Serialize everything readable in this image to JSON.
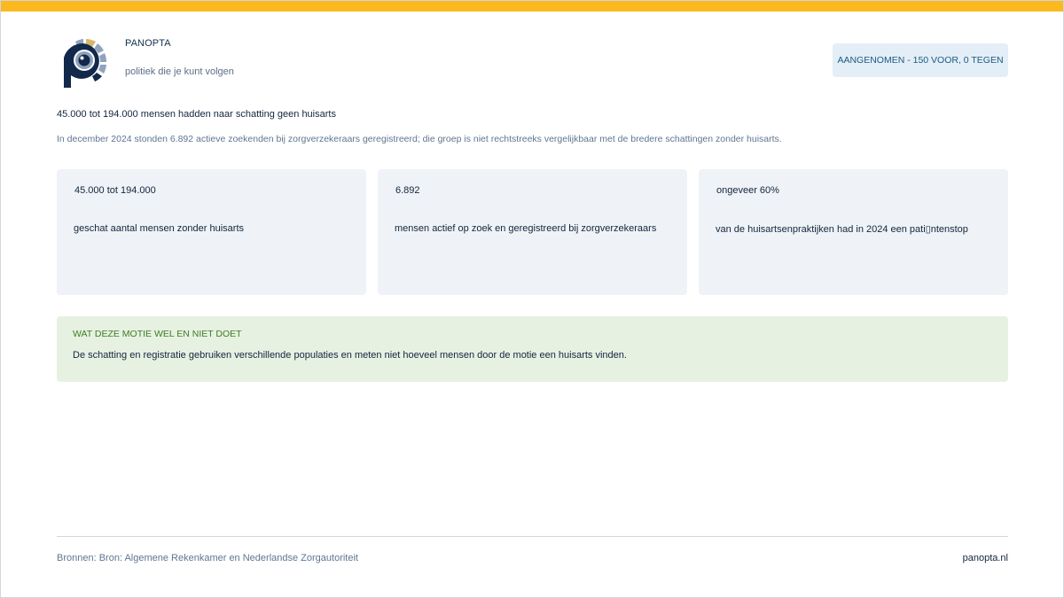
{
  "colors": {
    "accent_bar": "#fbb91f",
    "logo_navy": "#13294b",
    "logo_gold": "#d8b46f",
    "logo_slate": "#8fa3bd",
    "badge_bg": "#e3eef7",
    "card_bg": "#eff3f7",
    "note_bg": "#e6f1e2",
    "note_title": "#3f7d22"
  },
  "header": {
    "logo_icon": "panopta-eye-logo-icon",
    "brand_name": "PANOPTA",
    "tagline": "politiek die je kunt volgen",
    "status_badge": "AANGENOMEN - 150 VOOR, 0 TEGEN"
  },
  "main": {
    "headline": "45.000 tot 194.000 mensen hadden naar schatting geen huisarts",
    "subtext": "In december 2024 stonden 6.892 actieve zoekenden bij zorgverzekeraars geregistreerd; die groep is niet rechtstreeks vergelijkbaar met de bredere schattingen zonder huisarts.",
    "stats": [
      {
        "value": "45.000 tot 194.000",
        "label": "geschat aantal mensen zonder huisarts"
      },
      {
        "value": "6.892",
        "label": "mensen actief op zoek en geregistreerd bij zorgverzekeraars"
      },
      {
        "value": "ongeveer 60%",
        "label": "van de huisartsenpraktijken had in 2024 een pati▯ntenstop"
      }
    ],
    "note": {
      "title": "WAT DEZE MOTIE WEL EN NIET DOET",
      "text": "De schatting en registratie gebruiken verschillende populaties en meten niet hoeveel mensen door de motie een huisarts vinden."
    }
  },
  "footer": {
    "sources": "Bronnen: Bron: Algemene Rekenkamer en Nederlandse Zorgautoriteit",
    "site_link": "panopta.nl"
  }
}
